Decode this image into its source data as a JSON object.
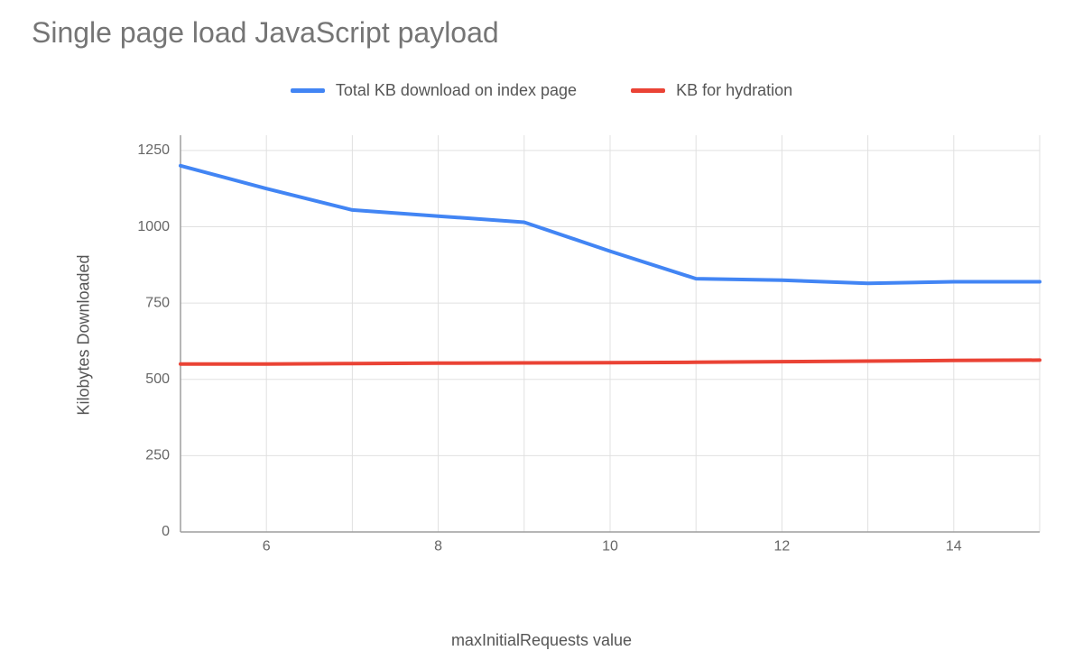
{
  "title": "Single page load JavaScript payload",
  "legend": {
    "series1": "Total KB download on index page",
    "series2": "KB for hydration"
  },
  "axes": {
    "xlabel": "maxInitialRequests value",
    "ylabel": "Kilobytes Downloaded"
  },
  "chart_data": {
    "type": "line",
    "xlabel": "maxInitialRequests value",
    "ylabel": "Kilobytes Downloaded",
    "title": "Single page load JavaScript payload",
    "x": [
      5,
      6,
      7,
      8,
      9,
      10,
      11,
      12,
      13,
      14,
      15
    ],
    "xlim": [
      5,
      15
    ],
    "ylim": [
      0,
      1300
    ],
    "yticks": [
      0,
      250,
      500,
      750,
      1000,
      1250
    ],
    "xticks": [
      6,
      8,
      10,
      12,
      14
    ],
    "series": [
      {
        "name": "Total KB download on index page",
        "color": "#4285f4",
        "values": [
          1200,
          1125,
          1055,
          1035,
          1015,
          920,
          830,
          825,
          815,
          820,
          820
        ]
      },
      {
        "name": "KB for hydration",
        "color": "#ea4335",
        "values": [
          550,
          550,
          552,
          553,
          554,
          555,
          556,
          558,
          560,
          562,
          563
        ]
      }
    ]
  }
}
